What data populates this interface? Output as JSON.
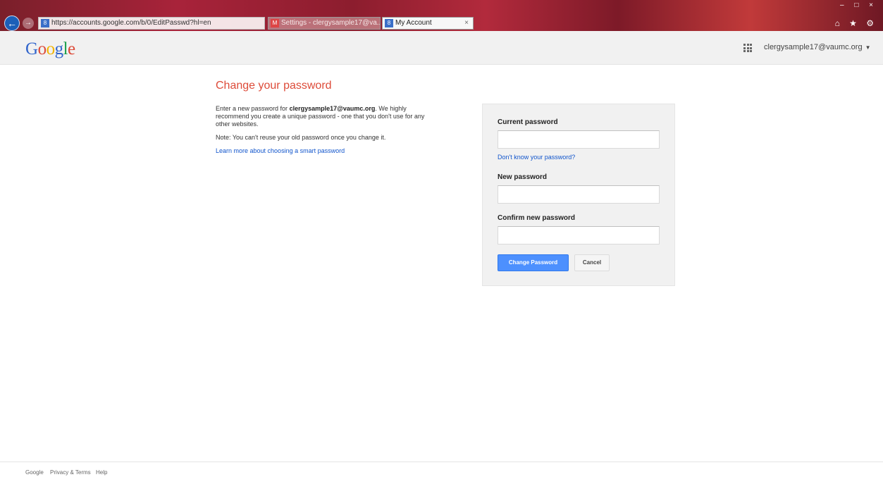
{
  "browser": {
    "address": "https://accounts.google.com/b/0/EditPasswd?hl=en",
    "tabs": [
      {
        "label": "Settings - clergysample17@va..."
      },
      {
        "label": "My Account"
      }
    ],
    "window_controls": "– □ ×",
    "toolbar_icons": "⌂ ★ ⚙"
  },
  "header": {
    "logo": {
      "c1": "G",
      "c2": "o",
      "c3": "o",
      "c4": "g",
      "c5": "l",
      "c6": "e"
    },
    "account_email": "clergysample17@vaumc.org"
  },
  "main": {
    "title": "Change your password",
    "intro_prefix": "Enter a new password for ",
    "intro_email": "clergysample17@vaumc.org",
    "intro_suffix": ". We highly recommend you create a unique password - one that you don't use for any other websites.",
    "note": "Note: You can't reuse your old password once you change it.",
    "learn_more": "Learn more about choosing a smart password"
  },
  "form": {
    "current_label": "Current password",
    "current_value": "",
    "forgot_link": "Don't know your password?",
    "new_label": "New password",
    "new_value": "",
    "confirm_label": "Confirm new password",
    "confirm_value": "",
    "submit_label": "Change Password",
    "cancel_label": "Cancel"
  },
  "footer": {
    "brand": "Google",
    "privacy": "Privacy & Terms",
    "help": "Help"
  },
  "colors": {
    "title_red": "#dd4b39",
    "link_blue": "#1155cc",
    "button_blue": "#4d90fe"
  }
}
